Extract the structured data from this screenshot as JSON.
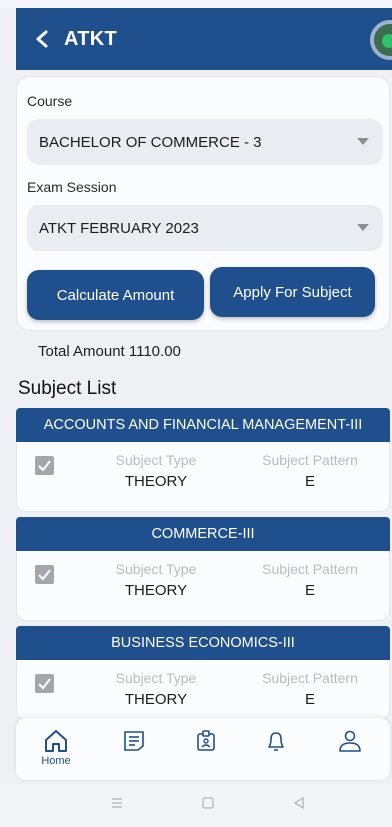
{
  "header": {
    "title": "ATKT"
  },
  "form": {
    "course_label": "Course",
    "course_value": "BACHELOR OF  COMMERCE - 3",
    "session_label": "Exam Session",
    "session_value": "ATKT FEBRUARY 2023",
    "calculate_label": "Calculate Amount",
    "apply_label": "Apply For Subject"
  },
  "total": {
    "text": "Total Amount 1110.00"
  },
  "subject_list": {
    "title": "Subject List",
    "type_label": "Subject Type",
    "pattern_label": "Subject Pattern",
    "items": [
      {
        "name": "ACCOUNTS AND FINANCIAL MANAGEMENT-III",
        "type": "THEORY",
        "pattern": "E",
        "checked": true
      },
      {
        "name": "COMMERCE-III",
        "type": "THEORY",
        "pattern": "E",
        "checked": true
      },
      {
        "name": "BUSINESS ECONOMICS-III",
        "type": "THEORY",
        "pattern": "E",
        "checked": true
      }
    ]
  },
  "bottom_nav": {
    "home_label": "Home",
    "icons": [
      "home-icon",
      "document-icon",
      "id-card-icon",
      "bell-icon",
      "profile-icon"
    ]
  },
  "colors": {
    "primary": "#1f4f8c",
    "background": "#eef0f4",
    "card": "#fbfcfd"
  }
}
